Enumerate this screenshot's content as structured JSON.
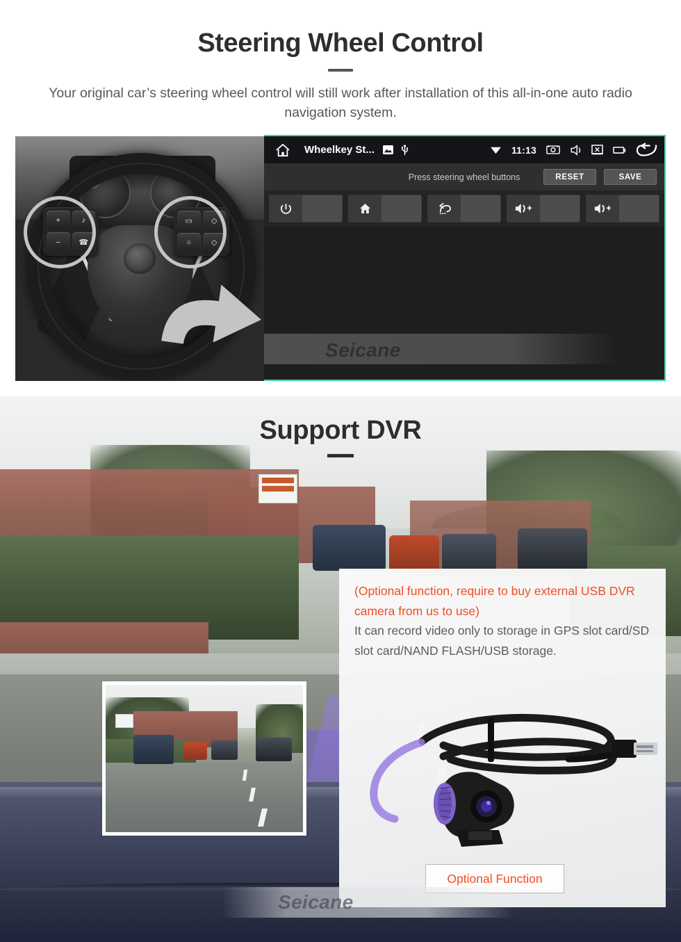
{
  "section1": {
    "title": "Steering Wheel Control",
    "subtitle": "Your original car’s steering wheel control will still work after installation of this all-in-one auto radio navigation system.",
    "watermark": "Seicane",
    "unit": {
      "statusbar": {
        "home_icon": "home-icon",
        "app_title": "Wheelkey St...",
        "image_icon": "image-icon",
        "usb_icon": "usb-icon",
        "wifi_icon": "wifi-icon",
        "clock": "11:13",
        "screenshot_icon": "screenshot-icon",
        "mute_icon": "mute-speaker-icon",
        "screen_off_icon": "screen-off-icon",
        "recents_icon": "recent-apps-icon",
        "back_icon": "back-arrow-icon"
      },
      "toolbar": {
        "hint": "Press steering wheel buttons",
        "reset_label": "RESET",
        "save_label": "SAVE"
      },
      "keys": [
        {
          "icon": "power-icon",
          "glyph": "⏻",
          "value": ""
        },
        {
          "icon": "home-icon",
          "glyph": "⌂",
          "value": ""
        },
        {
          "icon": "back-icon",
          "glyph": "↩",
          "value": ""
        },
        {
          "icon": "volume-up-icon",
          "glyph": "🔊+",
          "value": ""
        },
        {
          "icon": "volume-up-icon",
          "glyph": "🔊+",
          "value": ""
        }
      ]
    },
    "photo": {
      "alt": "steering-wheel-photo",
      "highlight_color": "#F5C526",
      "left_keys": [
        "+",
        "♪",
        "−",
        "☎"
      ],
      "right_keys": [
        "▭",
        "◇",
        "○",
        "◇"
      ]
    }
  },
  "section2": {
    "title": "Support DVR",
    "panel": {
      "note_orange": "(Optional function, require to buy external USB DVR camera from us to use)",
      "note_gray": "It can record video only to storage in GPS slot card/SD slot card/NAND FLASH/USB storage.",
      "button_label": "Optional Function"
    },
    "watermark": "Seicane",
    "inset_alt": "dashcam-street-view",
    "dvr_alt": "usb-dvr-camera-product"
  },
  "colors": {
    "orange": "#F04E23",
    "yellow": "#F5C526",
    "teal": "#3ecfa0",
    "heading": "#2e2e2e",
    "body": "#585858"
  }
}
